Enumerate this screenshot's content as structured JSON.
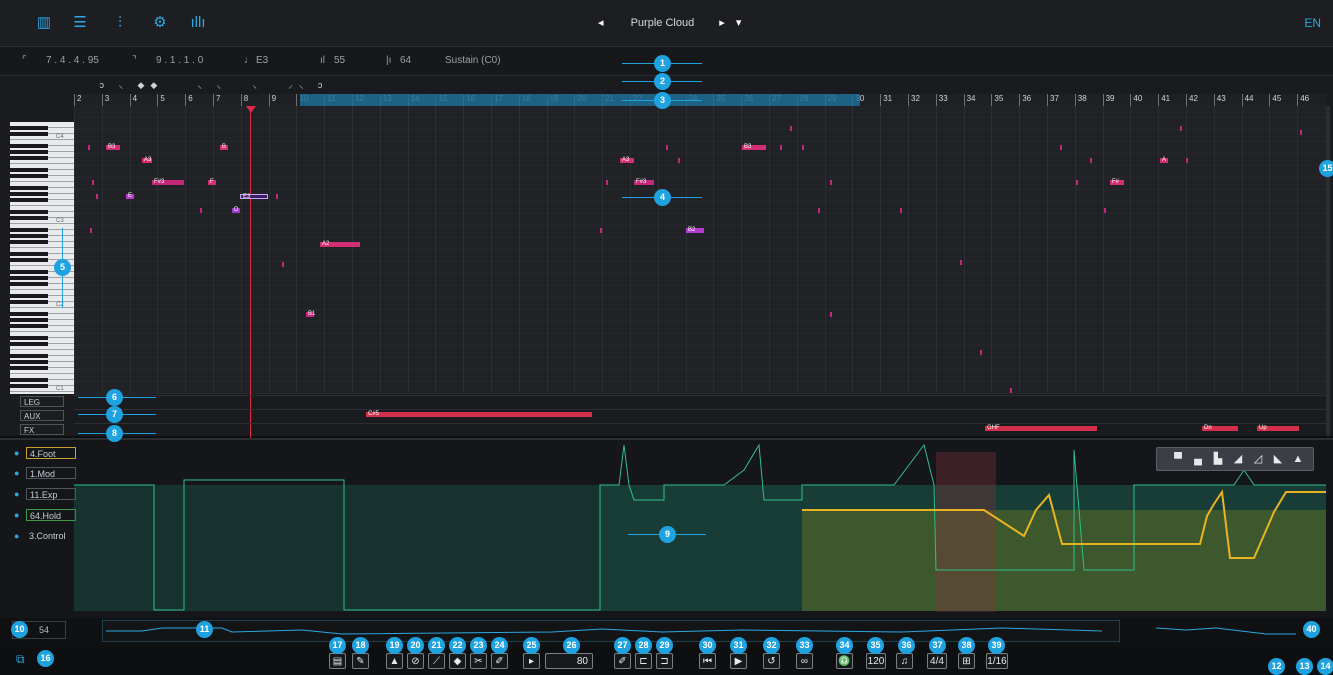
{
  "topbar": {
    "icons": [
      "piano-roll-icon",
      "sliders-icon",
      "mixer-icon",
      "gear-icon",
      "levels-icon"
    ],
    "preset_name": "Purple Cloud",
    "language": "EN"
  },
  "infobar": {
    "position": "7 . 4 . 4 . 95",
    "length": "9 . 1 . 1 . 0",
    "note": "E3",
    "velocity": "55",
    "value": "64",
    "controller": "Sustain (C0)"
  },
  "timeline": {
    "bars": [
      "2",
      "3",
      "4",
      "5",
      "6",
      "7",
      "8",
      "9",
      "10",
      "11",
      "12",
      "13",
      "14",
      "15",
      "16",
      "17",
      "18",
      "19",
      "20",
      "21",
      "22",
      "23",
      "24",
      "25",
      "26",
      "27",
      "28",
      "29",
      "30",
      "31",
      "32",
      "33",
      "34",
      "35",
      "36",
      "37",
      "38",
      "39",
      "40",
      "41",
      "42",
      "43",
      "44",
      "45",
      "46"
    ]
  },
  "keyboard": {
    "labels": [
      "C4",
      "C3",
      "C2",
      "C1"
    ]
  },
  "notes": [
    {
      "label": "B3",
      "color": "#d42f74"
    },
    {
      "label": "A3",
      "color": "#d42f74"
    },
    {
      "label": "F#3",
      "color": "#c4287a"
    },
    {
      "label": "E3",
      "color": "#7a38c6"
    },
    {
      "label": "B",
      "color": "#d42f74"
    },
    {
      "label": "E",
      "color": "#b43cd0"
    },
    {
      "label": "D",
      "color": "#9a3ad0"
    },
    {
      "label": "F",
      "color": "#d42f74"
    },
    {
      "label": "A2",
      "color": "#d42f74"
    },
    {
      "label": "B1",
      "color": "#c4287a"
    },
    {
      "label": "A3",
      "color": "#d42f74"
    },
    {
      "label": "F#3",
      "color": "#c4287a"
    },
    {
      "label": "B3",
      "color": "#d42f74"
    },
    {
      "label": "B2",
      "color": "#b43cd0"
    },
    {
      "label": "F#",
      "color": "#d42f74"
    },
    {
      "label": "A",
      "color": "#d42f74"
    }
  ],
  "lanes": {
    "leg": "LEG",
    "aux": "AUX",
    "fx": "FX",
    "aux_clip": "C#5",
    "fx_clips": [
      "GHF",
      "Dn",
      "Up"
    ]
  },
  "controllers": [
    "4.Foot",
    "1.Mod",
    "11.Exp",
    "64.Hold",
    "3.Control"
  ],
  "curve_shapes": [
    "step-icon",
    "step2-icon",
    "step3-icon",
    "ramp-icon",
    "ramp2-icon",
    "ramp3-icon",
    "triangle-icon"
  ],
  "navbar": {
    "zoom": "54"
  },
  "toolbar": {
    "velocity": "80",
    "tempo": "120",
    "time_signature": "4/4",
    "grid": "1/16"
  },
  "callouts": [
    "1",
    "2",
    "3",
    "4",
    "5",
    "6",
    "7",
    "8",
    "9",
    "10",
    "11",
    "12",
    "13",
    "14",
    "15",
    "16",
    "17",
    "18",
    "19",
    "20",
    "21",
    "22",
    "23",
    "24",
    "25",
    "26",
    "27",
    "28",
    "29",
    "30",
    "31",
    "32",
    "33",
    "34",
    "35",
    "36",
    "37",
    "38",
    "39",
    "40"
  ],
  "colors": {
    "accent": "#1fa3e0",
    "note": "#d42f74",
    "curve_green": "#2fbf8a",
    "curve_yellow": "#e8b422"
  }
}
